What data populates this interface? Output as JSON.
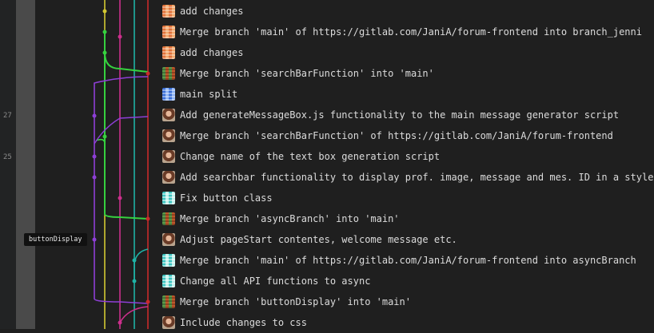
{
  "gutter": {
    "line_numbers": [
      {
        "label": "27",
        "row": 5
      },
      {
        "label": "25",
        "row": 7
      }
    ]
  },
  "branch_tags": [
    {
      "label": "buttonDisplay",
      "row": 11
    }
  ],
  "colors": {
    "background": "#1f1f1f",
    "text": "#dcdcdc",
    "lane_yellow": "#d2c832",
    "lane_magenta": "#cc2f8c",
    "lane_teal": "#1fb3a6",
    "lane_red": "#c92a2a",
    "lane_green": "#36d13f",
    "lane_purple": "#8e3fd6"
  },
  "commits": [
    {
      "message": "add changes",
      "avatar": "quilt-orange-avatar"
    },
    {
      "message": "Merge branch 'main' of https://gitlab.com/JaniA/forum-frontend into branch_jenni",
      "avatar": "quilt-orange-avatar"
    },
    {
      "message": "add changes",
      "avatar": "quilt-orange-avatar"
    },
    {
      "message": "Merge branch 'searchBarFunction' into 'main'",
      "avatar": "quilt-green-avatar"
    },
    {
      "message": "main split",
      "avatar": "quilt-blue-avatar"
    },
    {
      "message": "Add generateMessageBox.js functionality to the main message generator script",
      "avatar": "photo-avatar"
    },
    {
      "message": "Merge branch 'searchBarFunction' of https://gitlab.com/JaniA/forum-frontend",
      "avatar": "photo-avatar"
    },
    {
      "message": "Change name of the text box generation script",
      "avatar": "photo-avatar"
    },
    {
      "message": "Add searchbar functionality to display prof. image, message and mes. ID in a styled box",
      "avatar": "photo-avatar"
    },
    {
      "message": "Fix button class",
      "avatar": "quilt-cyan-avatar"
    },
    {
      "message": "Merge branch 'asyncBranch' into 'main'",
      "avatar": "quilt-green-avatar"
    },
    {
      "message": "Adjust pageStart contentes, welcome message etc.",
      "avatar": "photo-avatar"
    },
    {
      "message": "Merge branch 'main' of https://gitlab.com/JaniA/forum-frontend into asyncBranch",
      "avatar": "quilt-cyan-avatar"
    },
    {
      "message": "Change all API functions to async",
      "avatar": "quilt-cyan-avatar"
    },
    {
      "message": "Merge branch 'buttonDisplay' into 'main'",
      "avatar": "quilt-green-avatar"
    },
    {
      "message": "Include changes to css",
      "avatar": "photo-avatar"
    }
  ]
}
